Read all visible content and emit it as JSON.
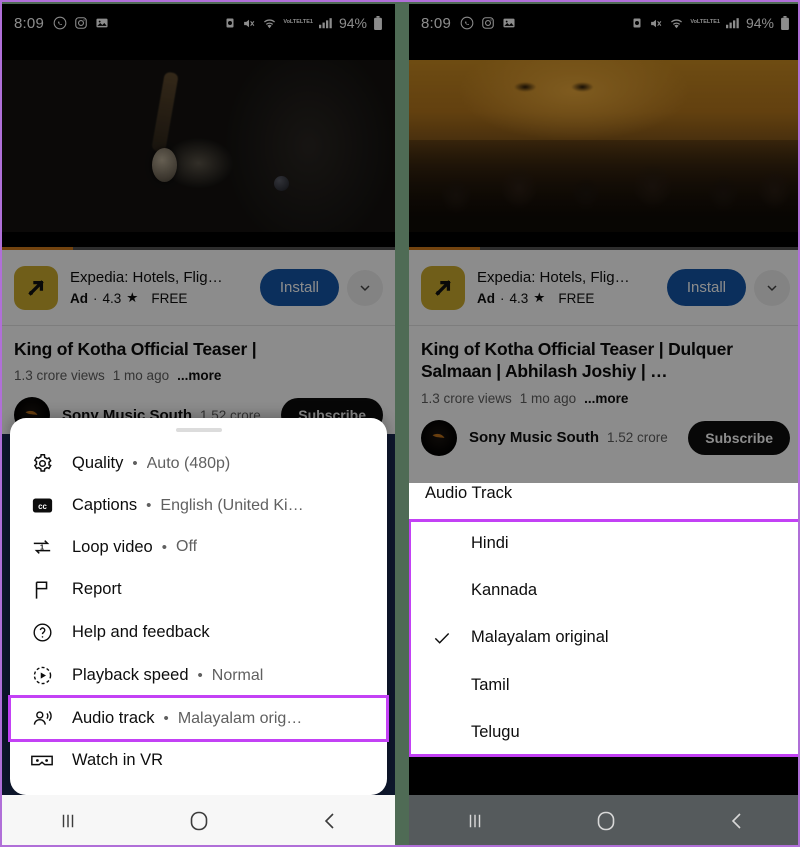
{
  "status_bar": {
    "time": "8:09",
    "left_icons": [
      "whatsapp-icon",
      "instagram-icon",
      "photos-icon"
    ],
    "right_icons": [
      "alarm-icon",
      "mute-icon",
      "wifi-icon",
      "volte-lte1-icon",
      "signal-bars-icon"
    ],
    "battery_percent": "94%",
    "network_label": "VoLTE",
    "network_sub": "LTE1"
  },
  "ad": {
    "title": "Expedia: Hotels, Flig…",
    "badge": "Ad",
    "separator": "·",
    "rating": "4.3",
    "star": "★",
    "price": "FREE",
    "install_label": "Install",
    "expand_icon": "chevron-down-icon",
    "icon_name": "expedia-logo-icon",
    "accent_color": "#1457a8",
    "icon_bg": "#ccab2e"
  },
  "video": {
    "title": "King of Kotha Official Teaser | Dulquer Salmaan | Abhilash Joshiy | …",
    "title_partial_left": "King of Kotha Official Teaser |",
    "views": "1.3 crore views",
    "age": "1 mo ago",
    "more_label": "...more",
    "progress_accent": "#cf7a1d"
  },
  "channel": {
    "name": "Sony Music South",
    "subscribers": "1.52 crore",
    "subscribe_label": "Subscribe",
    "avatar_name": "channel-avatar"
  },
  "left_sheet": {
    "grabber": "sheet-grabber",
    "items": [
      {
        "label": "Quality",
        "dot": "•",
        "value": "Auto (480p)",
        "icon": "gear-icon",
        "highlighted": false
      },
      {
        "label": "Captions",
        "dot": "•",
        "value": "English (United Ki…",
        "icon": "closed-captions-icon",
        "highlighted": false
      },
      {
        "label": "Loop video",
        "dot": "•",
        "value": "Off",
        "icon": "loop-icon",
        "highlighted": false
      },
      {
        "label": "Report",
        "dot": "",
        "value": "",
        "icon": "flag-icon",
        "highlighted": false
      },
      {
        "label": "Help and feedback",
        "dot": "",
        "value": "",
        "icon": "help-circle-icon",
        "highlighted": false
      },
      {
        "label": "Playback speed",
        "dot": "•",
        "value": "Normal",
        "icon": "playback-speed-icon",
        "highlighted": false
      },
      {
        "label": "Audio track",
        "dot": "•",
        "value": "Malayalam orig…",
        "icon": "audio-track-icon",
        "highlighted": true
      },
      {
        "label": "Watch in VR",
        "dot": "",
        "value": "",
        "icon": "vr-goggles-icon",
        "highlighted": false
      }
    ]
  },
  "audio_track_panel": {
    "header": "Audio Track",
    "options": [
      {
        "label": "Hindi",
        "selected": false
      },
      {
        "label": "Kannada",
        "selected": false
      },
      {
        "label": "Malayalam original",
        "selected": true
      },
      {
        "label": "Tamil",
        "selected": false
      },
      {
        "label": "Telugu",
        "selected": false
      }
    ],
    "check_icon": "check-icon"
  },
  "nav_bar": {
    "recents": "recents-icon",
    "home": "home-icon",
    "back": "back-icon"
  },
  "highlight_color": "#c341f5"
}
